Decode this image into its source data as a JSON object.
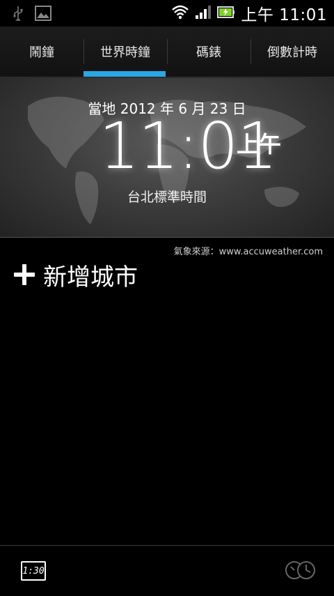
{
  "status_bar": {
    "time": "上午 11:01",
    "icons": [
      "usb-icon",
      "image-icon",
      "wifi-icon",
      "signal-icon",
      "battery-icon"
    ]
  },
  "tabs": [
    {
      "label": "鬧鐘",
      "active": false
    },
    {
      "label": "世界時鐘",
      "active": true
    },
    {
      "label": "碼錶",
      "active": false
    },
    {
      "label": "倒數計時",
      "active": false
    }
  ],
  "clock": {
    "date": "當地  2012 年 6 月 23 日",
    "time": "11:01",
    "ampm": "上午",
    "timezone": "台北標準時間"
  },
  "weather_source": "氣象來源：www.accuweather.com",
  "add_city_label": "新增城市",
  "bottom_bar": {
    "digital_label": "1:30",
    "icons": [
      "digital-clock-icon",
      "analog-clock-icon"
    ]
  },
  "colors": {
    "accent": "#2aa7e4",
    "background": "#000000"
  }
}
